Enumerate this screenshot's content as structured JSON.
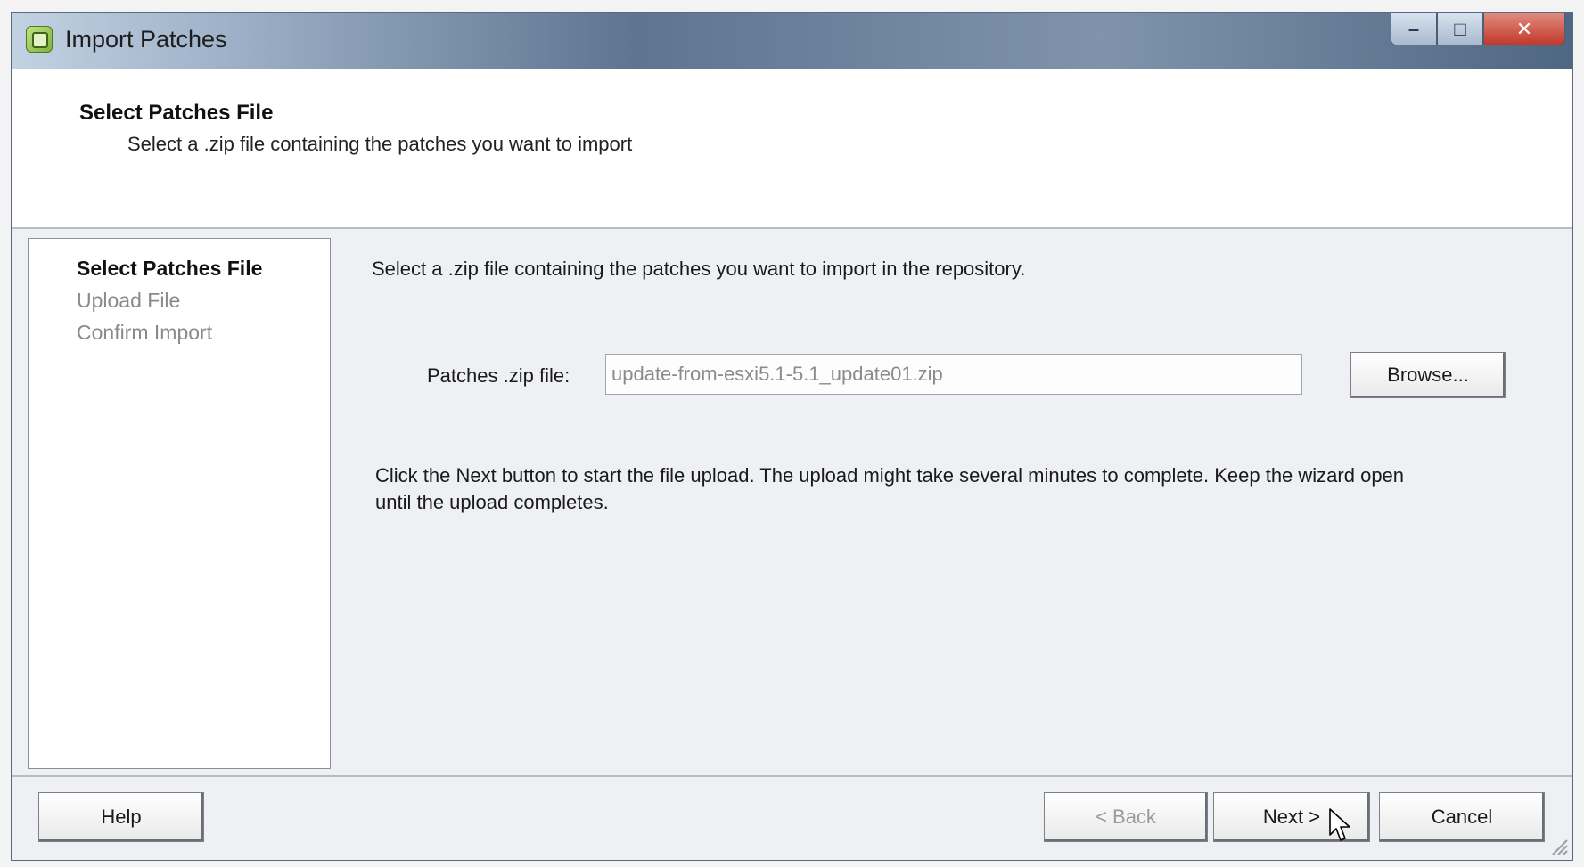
{
  "window": {
    "title": "Import Patches"
  },
  "header": {
    "title": "Select Patches File",
    "subtitle": "Select a .zip file containing the patches you want to import"
  },
  "steps": [
    {
      "label": "Select Patches File",
      "state": "current"
    },
    {
      "label": "Upload File",
      "state": "pending"
    },
    {
      "label": "Confirm Import",
      "state": "pending"
    }
  ],
  "main": {
    "instruction": "Select a .zip file containing the patches you want to import in the repository.",
    "field_label": "Patches .zip file:",
    "field_value": "update-from-esxi5.1-5.1_update01.zip",
    "browse_label": "Browse...",
    "hint": "Click the Next button to start the file upload. The upload might take several minutes to complete. Keep the wizard open until the upload completes."
  },
  "footer": {
    "help_label": "Help",
    "back_label": "< Back",
    "next_label": "Next >",
    "cancel_label": "Cancel"
  },
  "icons": {
    "app": "import-patches-app-icon",
    "cursor": "mouse-pointer-icon",
    "resize": "resize-grip-icon"
  }
}
